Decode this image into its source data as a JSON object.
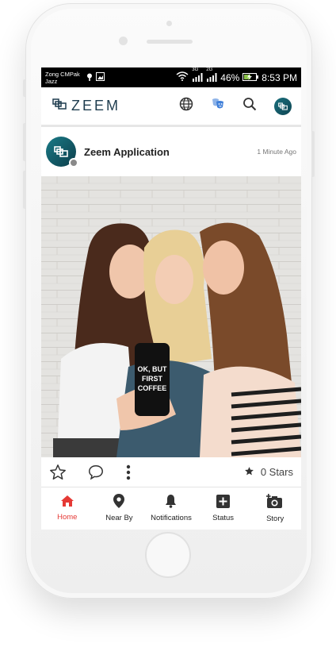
{
  "status_bar": {
    "carrier_line1": "Zong CMPak",
    "carrier_line2": "Jazz",
    "network_1": "3G",
    "network_2": "2G",
    "battery": "46%",
    "time": "8:53 PM"
  },
  "app": {
    "logo_text": "ZEEM",
    "accent_color": "#e53935",
    "brand_color": "#1a6f7d"
  },
  "post": {
    "author": "Zeem Application",
    "time": "1 Minute Ago",
    "photo_phone_text": "OK, BUT FIRST COFFEE",
    "stars_label": "0 Stars"
  },
  "bottom_nav": [
    {
      "label": "Home",
      "icon": "home-icon",
      "active": true
    },
    {
      "label": "Near By",
      "icon": "location-pin-icon",
      "active": false
    },
    {
      "label": "Notifications",
      "icon": "bell-icon",
      "active": false
    },
    {
      "label": "Status",
      "icon": "plus-square-icon",
      "active": false
    },
    {
      "label": "Story",
      "icon": "camera-plus-icon",
      "active": false
    }
  ]
}
